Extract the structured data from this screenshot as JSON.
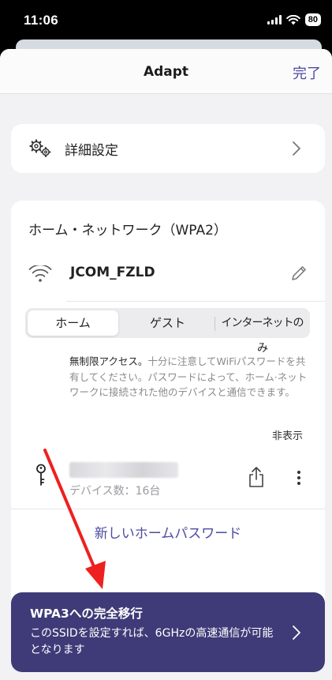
{
  "status_bar": {
    "time": "11:06",
    "battery": "80"
  },
  "nav": {
    "title": "Adapt",
    "done_label": "完了"
  },
  "advanced": {
    "label": "詳細設定",
    "icon": "gears-icon"
  },
  "network": {
    "title": "ホーム・ネットワーク（WPA2）",
    "ssid": "JCOM_FZLD",
    "tabs": [
      "ホーム",
      "ゲスト",
      "インターネットのみ"
    ],
    "selected_tab": "ホーム",
    "description_bold": "無制限アクセス。",
    "description_rest": "十分に注意してWiFiパスワードを共有してください。パスワードによって、ホーム·ネットワークに接続された他のデバイスと通信できます。",
    "hide_label": "非表示",
    "device_count": "デバイス数：16台",
    "new_password_label": "新しいホームパスワード"
  },
  "banner": {
    "title": "WPA3への完全移行",
    "body": "このSSIDを設定すれば、6GHzの高速通信が可能となります"
  },
  "colors": {
    "accent": "#4e4aa3",
    "banner_bg": "#3f3b78",
    "annotation_arrow": "#ee2020"
  }
}
